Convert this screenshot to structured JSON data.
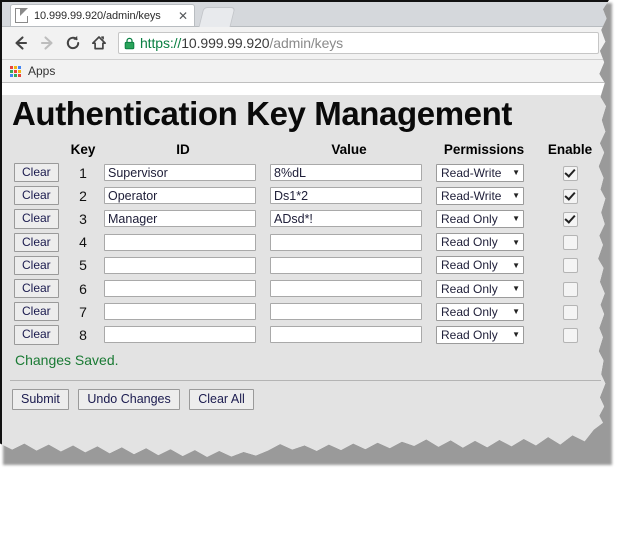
{
  "browser": {
    "tab": {
      "title": "10.999.99.920/admin/keys",
      "page_icon": "page-icon",
      "close_icon": "✕"
    },
    "nav": {
      "back_icon": "back-arrow-icon",
      "forward_icon": "forward-arrow-icon",
      "reload_icon": "reload-icon",
      "home_icon": "home-icon"
    },
    "url": {
      "scheme": "https://",
      "host": "10.999.99.920",
      "path": "/admin/keys",
      "lock_icon": "lock-icon"
    },
    "bookmarks": {
      "apps_label": "Apps",
      "apps_icon": "apps-grid-icon",
      "apps_icon_colors": [
        "#e8453c",
        "#f2b50f",
        "#4285f4",
        "#34a853",
        "#e8453c",
        "#f2b50f",
        "#4285f4",
        "#34a853",
        "#e8453c"
      ]
    }
  },
  "page": {
    "title": "Authentication Key Management",
    "status_message": "Changes Saved.",
    "status_color": "#1a7a34"
  },
  "table": {
    "headers": {
      "clear": "",
      "key": "Key",
      "id": "ID",
      "value": "Value",
      "permissions": "Permissions",
      "enable": "Enable"
    },
    "clear_button_label": "Clear",
    "caret_glyph": "▼",
    "permission_options": [
      "Read Only",
      "Read-Write"
    ],
    "rows": [
      {
        "key": "1",
        "id": "Supervisor",
        "value": "8%dL",
        "permission": "Read-Write",
        "enabled": true,
        "clear_label": "Clear"
      },
      {
        "key": "2",
        "id": "Operator",
        "value": "Ds1*2",
        "permission": "Read-Write",
        "enabled": true,
        "clear_label": "Clear"
      },
      {
        "key": "3",
        "id": "Manager",
        "value": "ADsd*!",
        "permission": "Read Only",
        "enabled": true,
        "clear_label": "Clear"
      },
      {
        "key": "4",
        "id": "",
        "value": "",
        "permission": "Read Only",
        "enabled": false,
        "clear_label": "Clear"
      },
      {
        "key": "5",
        "id": "",
        "value": "",
        "permission": "Read Only",
        "enabled": false,
        "clear_label": "Clear"
      },
      {
        "key": "6",
        "id": "",
        "value": "",
        "permission": "Read Only",
        "enabled": false,
        "clear_label": "Clear"
      },
      {
        "key": "7",
        "id": "",
        "value": "",
        "permission": "Read Only",
        "enabled": false,
        "clear_label": "Clear"
      },
      {
        "key": "8",
        "id": "",
        "value": "",
        "permission": "Read Only",
        "enabled": false,
        "clear_label": "Clear"
      }
    ]
  },
  "actions": {
    "submit_label": "Submit",
    "undo_label": "Undo Changes",
    "clear_all_label": "Clear All"
  }
}
